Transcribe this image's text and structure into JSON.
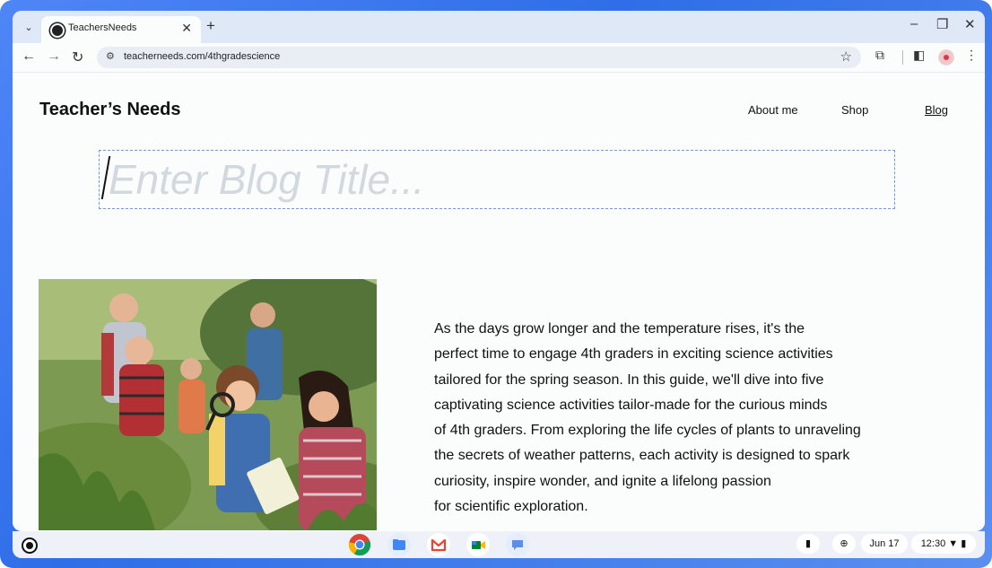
{
  "browser": {
    "tab_title": "TeachersNeeds",
    "url": "teacherneeds.com/4thgradescience",
    "icons": {
      "tab_list": "chevron-down-icon",
      "close_tab": "close-icon",
      "new_tab": "plus-icon",
      "back": "arrow-left-icon",
      "forward": "arrow-right-icon",
      "reload": "reload-icon",
      "site_info": "tune-icon",
      "bookmark": "star-icon",
      "extensions": "puzzle-icon",
      "side_panel": "side-panel-icon",
      "menu": "more-vertical-icon",
      "minimize": "minimize-icon",
      "restore": "restore-icon",
      "close_window": "close-icon"
    },
    "glyphs": {
      "tab_list": "⌄",
      "close": "✕",
      "new_tab": "+",
      "back": "←",
      "forward": "→",
      "reload": "↻",
      "tune": "⚙",
      "star": "☆",
      "puzzle": "⧉",
      "side_panel": "◧",
      "menu": "⋮",
      "minimize": "–",
      "restore": "❐"
    }
  },
  "site": {
    "brand": "Teacher’s Needs",
    "nav": [
      "About me",
      "Shop",
      "Blog"
    ],
    "title_placeholder": "Enter Blog Title...",
    "article_lines": [
      "As the days grow longer and the temperature rises, it's the",
      "perfect time to engage 4th graders in exciting science activities",
      "tailored for the spring season. In this guide, we'll dive into five",
      "captivating science activities tailor-made for the curious minds",
      "of 4th graders. From exploring the life cycles of plants to unraveling",
      "the secrets of weather patterns, each activity is designed to spark",
      "curiosity, inspire wonder, and ignite a lifelong passion",
      "for scientific exploration."
    ]
  },
  "shelf": {
    "apps": [
      "chrome-icon",
      "files-icon",
      "gmail-icon",
      "meet-icon",
      "chat-icon"
    ],
    "date": "Jun 17",
    "time": "12:30",
    "icons": [
      "launcher-icon",
      "tote-icon",
      "add-icon",
      "wifi-icon",
      "battery-icon"
    ]
  },
  "colors": {
    "accent": "#4f86f7",
    "title_border": "#7b93e3",
    "placeholder": "#d2d9de"
  }
}
